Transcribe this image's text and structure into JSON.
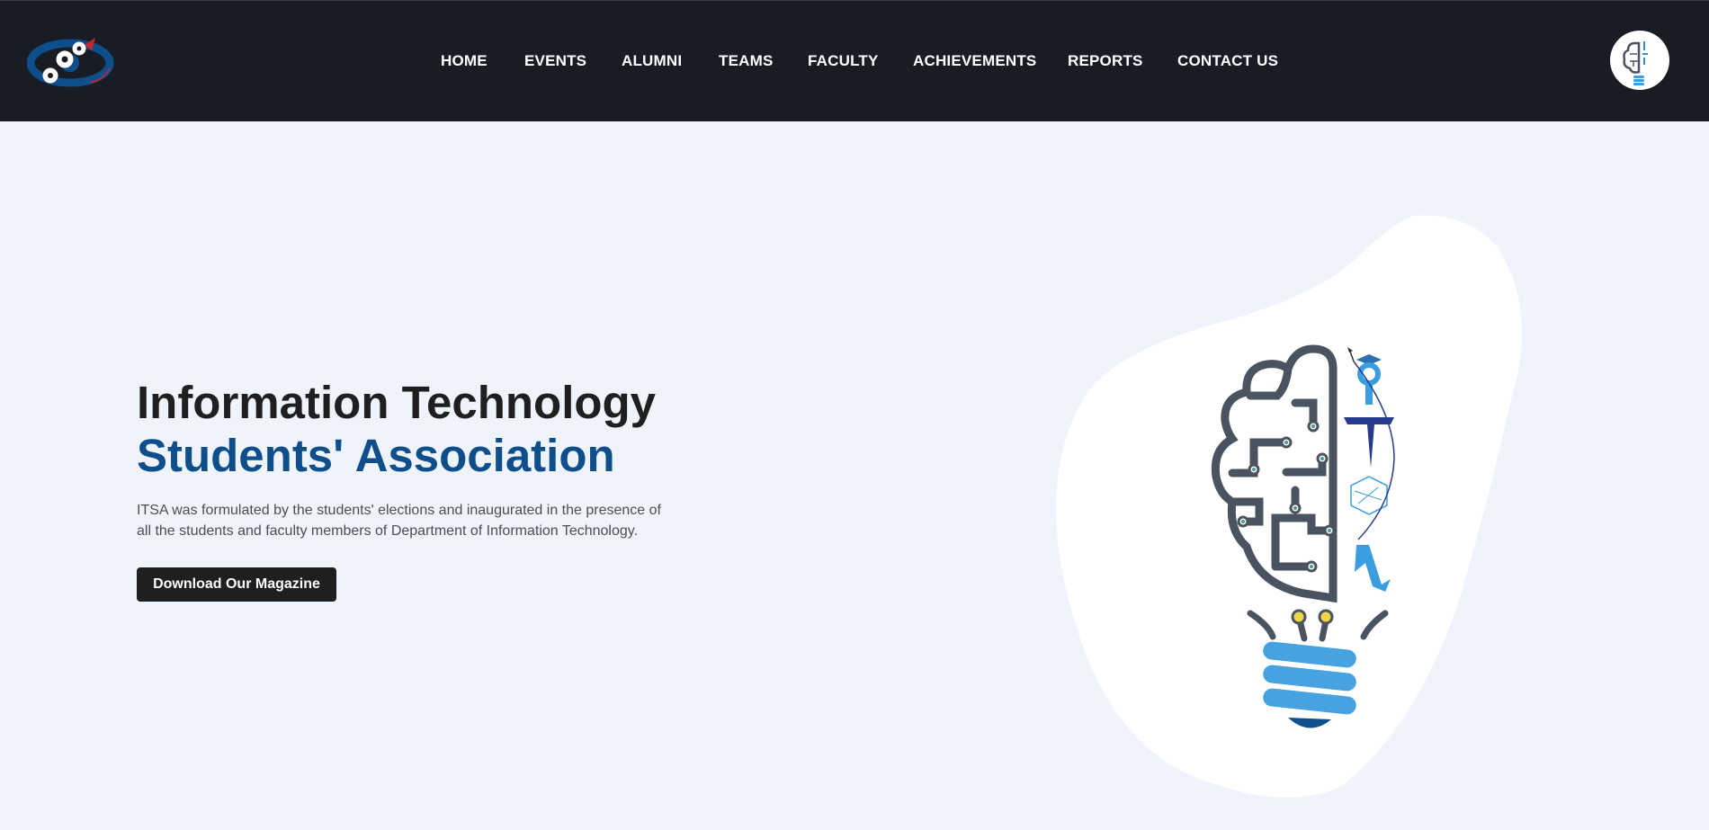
{
  "nav": {
    "items": [
      {
        "label": "HOME"
      },
      {
        "label": "EVENTS"
      },
      {
        "label": "ALUMNI"
      },
      {
        "label": "TEAMS"
      },
      {
        "label": "FACULTY"
      },
      {
        "label": "ACHIEVEMENTS"
      },
      {
        "label": "REPORTS"
      },
      {
        "label": "CONTACT US"
      }
    ]
  },
  "hero": {
    "title_line1": "Information Technology",
    "title_line2": "Students' Association",
    "description": "ITSA was formulated by the students' elections and inaugurated in the presence of all the students and faculty members of Department of Information Technology.",
    "cta_label": "Download Our Magazine"
  },
  "colors": {
    "navbar_bg": "#181c25",
    "page_bg": "#eef3fc",
    "accent_blue": "#0e4e8a",
    "button_bg": "#1f1f1f"
  },
  "icons": {
    "college_logo": "college-gears-eye-logo",
    "itsa_logo": "itsa-brain-bulb-logo"
  }
}
